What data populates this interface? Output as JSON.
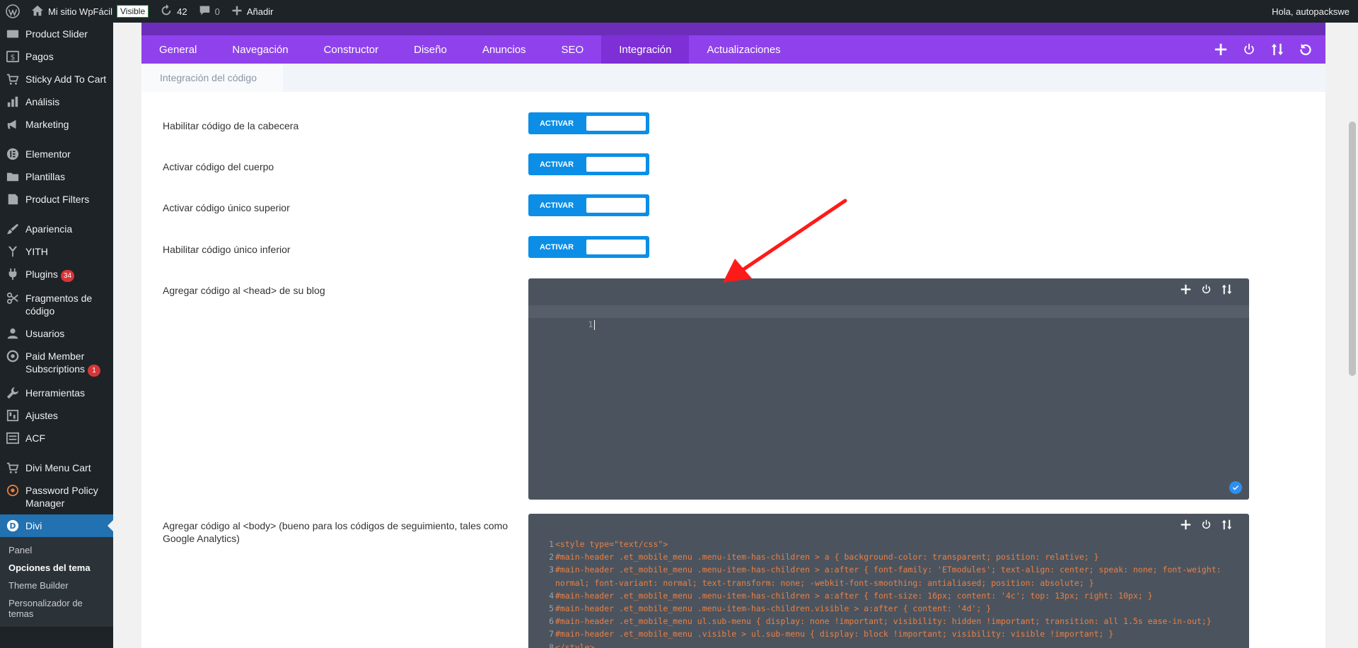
{
  "adminbar": {
    "site_name": "Mi sitio WpFácil",
    "visible_label": "Visible",
    "updates_count": "42",
    "comments_count": "0",
    "add_label": "Añadir",
    "greeting": "Hola, autopackswe"
  },
  "sidebar": {
    "items": [
      {
        "label": "Product Slider",
        "icon": "slider-icon"
      },
      {
        "label": "Pagos",
        "icon": "dollar-icon"
      },
      {
        "label": "Sticky Add To Cart",
        "icon": "cart-icon"
      },
      {
        "label": "Análisis",
        "icon": "bar-chart-icon"
      },
      {
        "label": "Marketing",
        "icon": "megaphone-icon"
      },
      {
        "label": "Elementor",
        "icon": "elementor-icon"
      },
      {
        "label": "Plantillas",
        "icon": "folder-icon"
      },
      {
        "label": "Product Filters",
        "icon": "filter-icon"
      },
      {
        "label": "Apariencia",
        "icon": "brush-icon"
      },
      {
        "label": "YITH",
        "icon": "yith-icon"
      },
      {
        "label": "Plugins",
        "icon": "plugin-icon",
        "badge": "34"
      },
      {
        "label": "Fragmentos de código",
        "icon": "scissors-icon"
      },
      {
        "label": "Usuarios",
        "icon": "user-icon"
      },
      {
        "label": "Paid Member Subscriptions",
        "icon": "subscriptions-icon",
        "badge": "1"
      },
      {
        "label": "Herramientas",
        "icon": "wrench-icon"
      },
      {
        "label": "Ajustes",
        "icon": "settings-icon"
      },
      {
        "label": "ACF",
        "icon": "acf-icon"
      },
      {
        "label": "Divi Menu Cart",
        "icon": "cart-icon"
      },
      {
        "label": "Password Policy Manager",
        "icon": "lock-icon"
      },
      {
        "label": "Divi",
        "icon": "divi-icon"
      }
    ],
    "submenu": [
      "Panel",
      "Opciones del tema",
      "Theme Builder",
      "Personalizador de temas"
    ]
  },
  "tabs": [
    "General",
    "Navegación",
    "Constructor",
    "Diseño",
    "Anuncios",
    "SEO",
    "Integración",
    "Actualizaciones"
  ],
  "active_tab": "Integración",
  "subtab": "Integración del código",
  "options": [
    {
      "label": "Habilitar código de la cabecera",
      "toggle": "ACTIVAR"
    },
    {
      "label": "Activar código del cuerpo",
      "toggle": "ACTIVAR"
    },
    {
      "label": "Activar código único superior",
      "toggle": "ACTIVAR"
    },
    {
      "label": "Habilitar código único inferior",
      "toggle": "ACTIVAR"
    }
  ],
  "head_code": {
    "label": "Agregar código al <head> de su blog",
    "line_number": "1"
  },
  "body_code": {
    "label": "Agregar código al <body> (bueno para los códigos de seguimiento, tales como Google Analytics)",
    "lines": [
      "<style type=\"text/css\">",
      "#main-header .et_mobile_menu .menu-item-has-children > a { background-color: transparent; position: relative; }",
      "#main-header .et_mobile_menu .menu-item-has-children > a:after { font-family: 'ETmodules'; text-align: center; speak: none; font-weight: normal; font-variant: normal; text-transform: none; -webkit-font-smoothing: antialiased; position: absolute; }",
      "#main-header .et_mobile_menu .menu-item-has-children > a:after { font-size: 16px; content: '4c'; top: 13px; right: 10px; }",
      "#main-header .et_mobile_menu .menu-item-has-children.visible > a:after { content: '4d'; }",
      "#main-header .et_mobile_menu ul.sub-menu { display: none !important; visibility: hidden !important; transition: all 1.5s ease-in-out;}",
      "#main-header .et_mobile_menu .visible > ul.sub-menu { display: block !important; visibility: visible !important; }",
      "</style>"
    ]
  },
  "colors": {
    "tabs_bg": "#8f42ec",
    "tab_active": "#7e2fd6",
    "toggle_blue": "#0c8ee7",
    "editor_bg": "#4b545e",
    "wp_active": "#2271b1",
    "arrow_red": "#ff1a1a"
  }
}
